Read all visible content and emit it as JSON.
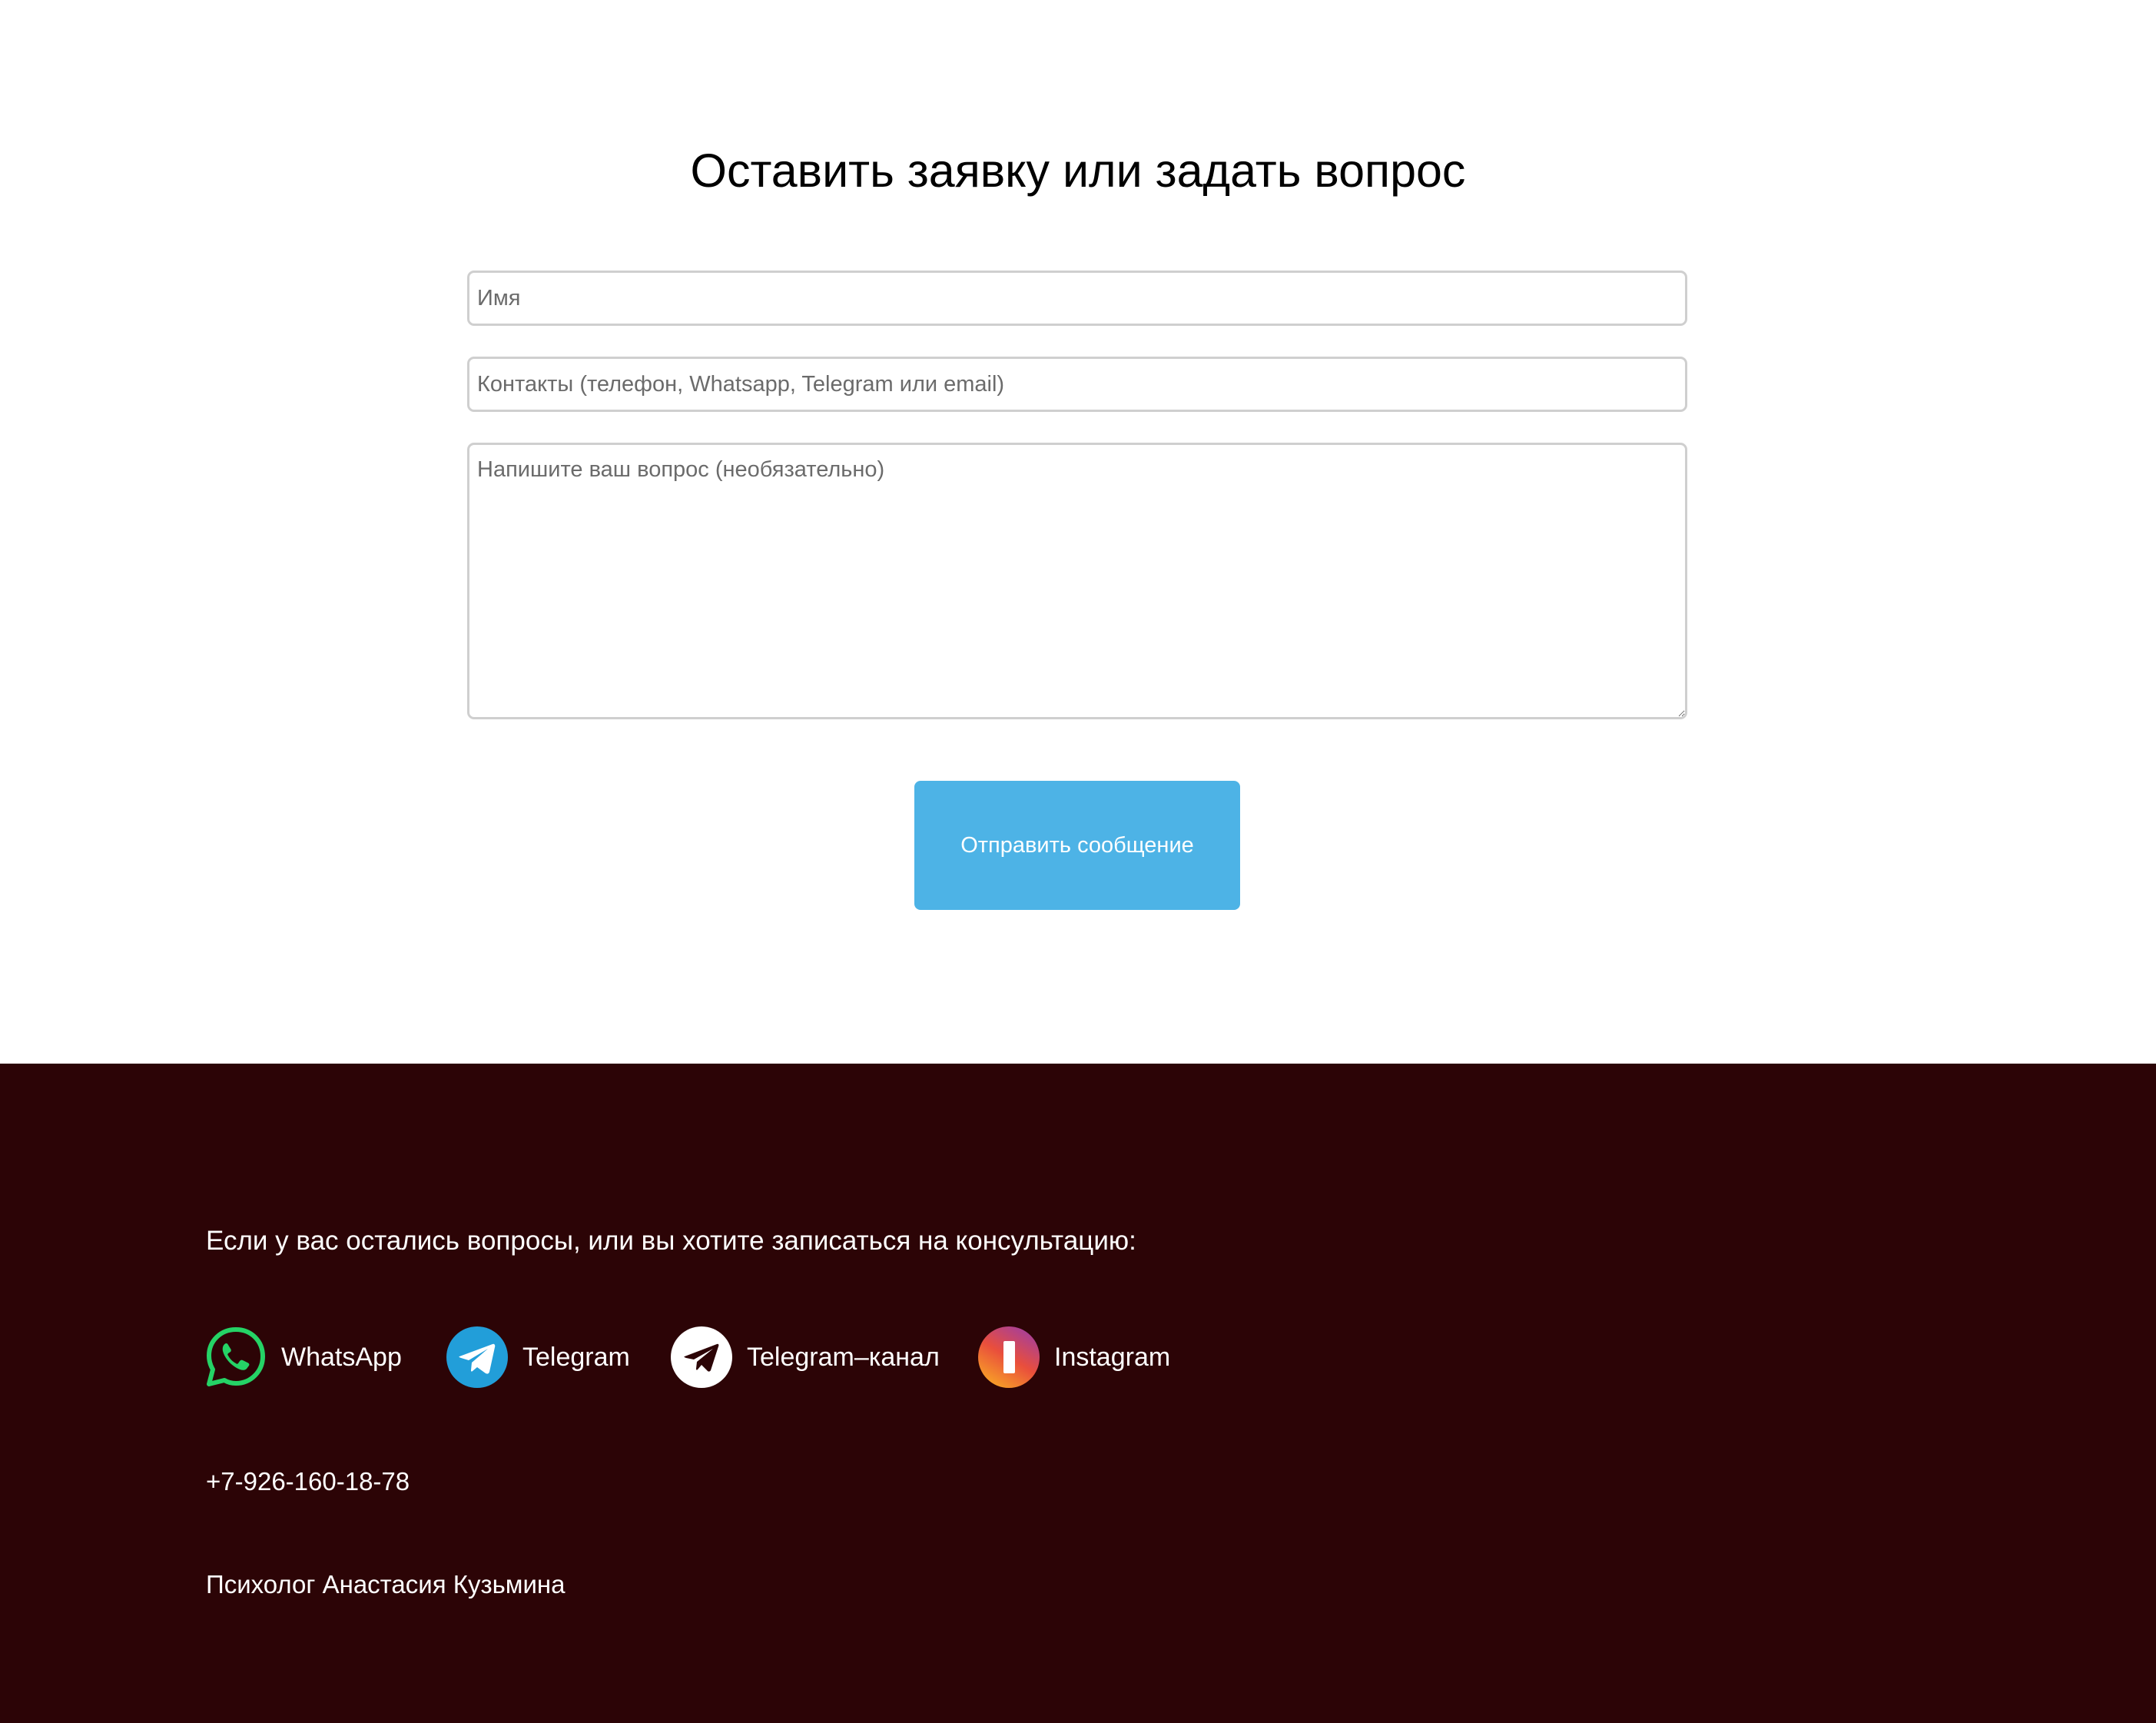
{
  "form": {
    "title": "Оставить заявку или задать вопрос",
    "name_placeholder": "Имя",
    "contacts_placeholder": "Контакты (телефон, Whatsapp, Telegram или email)",
    "question_placeholder": "Напишите ваш вопрос (необязательно)",
    "submit_label": "Отправить сообщение"
  },
  "colors": {
    "submit_button": "#4db3e6",
    "footer_background": "#2c0406",
    "whatsapp": "#25d366",
    "telegram": "#229ed9"
  },
  "footer": {
    "heading": "Если у вас остались вопросы, или вы хотите записаться на консультацию:",
    "social": [
      {
        "label": "WhatsApp",
        "icon": "whatsapp-icon"
      },
      {
        "label": "Telegram",
        "icon": "telegram-icon"
      },
      {
        "label": "Telegram–канал",
        "icon": "telegram-channel-icon"
      },
      {
        "label": "Instagram",
        "icon": "instagram-icon"
      }
    ],
    "phone": "+7-926-160-18-78",
    "owner": "Психолог Анастасия Кузьмина"
  }
}
